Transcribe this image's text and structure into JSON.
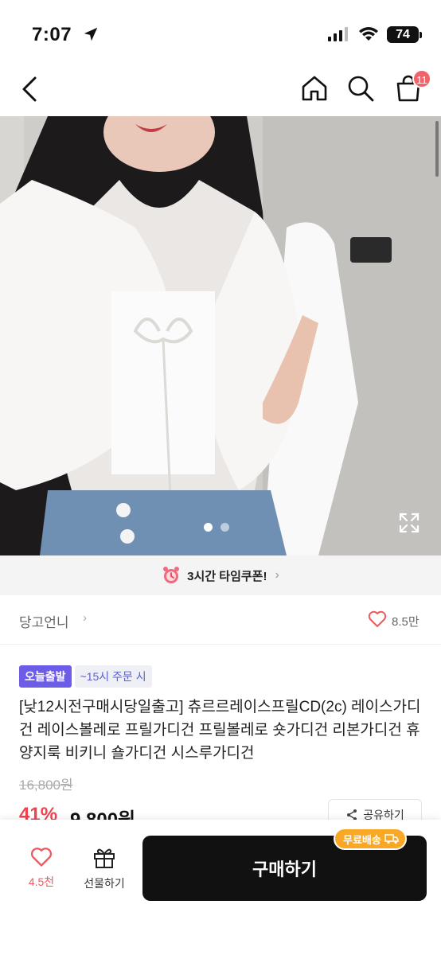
{
  "status_bar": {
    "time": "7:07",
    "battery": "74"
  },
  "nav": {
    "cart_count": "11"
  },
  "gallery": {
    "current_page": 1,
    "total_pages": 2
  },
  "coupon": {
    "text": "3시간 타임쿠폰!",
    "chevron": "›"
  },
  "store": {
    "name": "당고언니",
    "chevron": "›",
    "likes": "8.5만"
  },
  "badges": {
    "today": "오늘출발",
    "cutoff": "~15시 주문 시"
  },
  "product": {
    "title": "[낮12시전구매시당일출고] 츄르르레이스프릴CD(2c) 레이스가디건 레이스볼레로 프릴가디건 프릴볼레로 숏가디건 리본가디건 휴양지룩 비키니 숄가디건 시스루가디건",
    "original_price": "16,800원",
    "discount": "41%",
    "sale_price": "9,800원"
  },
  "share": {
    "label": "공유하기"
  },
  "bottom": {
    "wish_count": "4.5천",
    "gift_label": "선물하기",
    "buy_label": "구매하기",
    "free_shipping": "무료배송"
  },
  "colors": {
    "accent_red": "#f0434f",
    "badge_purple": "#6c5ce7",
    "shipping_orange": "#f9a825",
    "buy_black": "#111111"
  }
}
